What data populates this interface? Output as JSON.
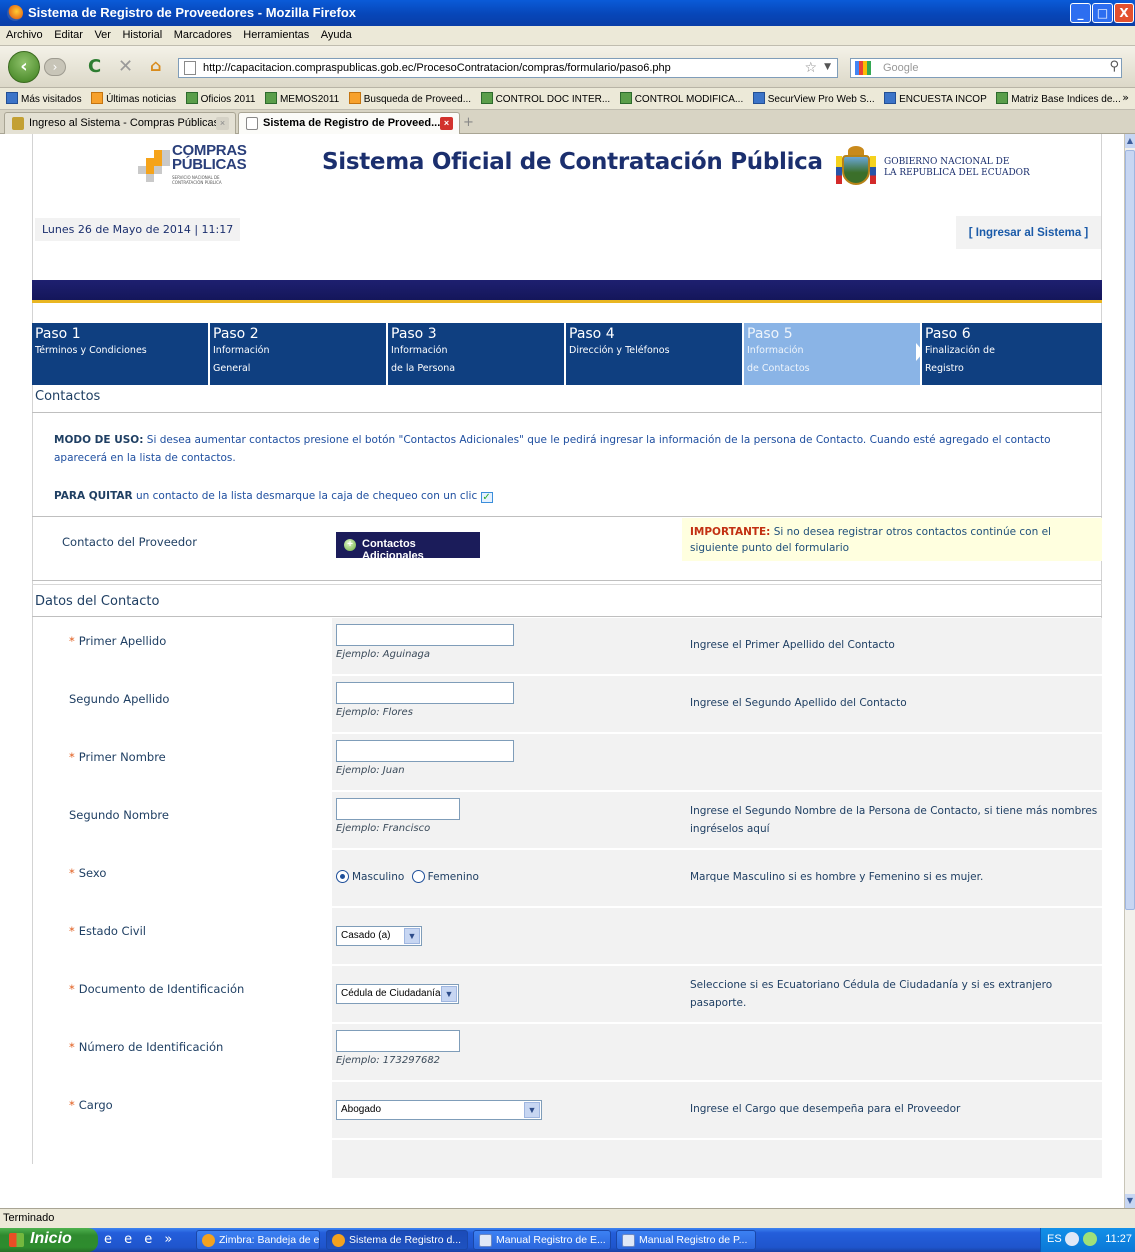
{
  "window": {
    "title": "Sistema de Registro de Proveedores - Mozilla Firefox",
    "buttons": {
      "minimize": "_",
      "maximize": "□",
      "close": "X"
    }
  },
  "menu": [
    "Archivo",
    "Editar",
    "Ver",
    "Historial",
    "Marcadores",
    "Herramientas",
    "Ayuda"
  ],
  "navbar": {
    "url": "http://capacitacion.compraspublicas.gob.ec/ProcesoContratacion/compras/formulario/paso6.php",
    "search_placeholder": "Google"
  },
  "bookmarks": [
    {
      "label": "Más visitados",
      "icon": "page-icon"
    },
    {
      "label": "Últimas noticias",
      "icon": "rss-icon"
    },
    {
      "label": "Oficios 2011",
      "icon": "sheet-icon"
    },
    {
      "label": "MEMOS2011",
      "icon": "sheet-icon"
    },
    {
      "label": "Busqueda de Proveed...",
      "icon": "crest-icon"
    },
    {
      "label": "CONTROL DOC INTER...",
      "icon": "sheet-icon"
    },
    {
      "label": "CONTROL MODIFICA...",
      "icon": "sheet-icon"
    },
    {
      "label": "SecurView Pro Web S...",
      "icon": "globe-icon"
    },
    {
      "label": "ENCUESTA INCOP",
      "icon": "google-icon"
    },
    {
      "label": "Matriz Base Indices de...",
      "icon": "sheet-icon"
    }
  ],
  "bookmarks_more": "»",
  "tabs": [
    {
      "label": "Ingreso al Sistema - Compras Públicas",
      "active": false
    },
    {
      "label": "Sistema de Registro de Proveed...",
      "active": true
    }
  ],
  "header": {
    "logo_line1": "COMPRAS",
    "logo_line2": "PÚBLICAS",
    "logo_tagline": "SERVICIO NACIONAL DE CONTRATACIÓN PÚBLICA",
    "site_title": "Sistema Oficial de Contratación Pública",
    "gov_line1": "GOBIERNO NACIONAL DE",
    "gov_line2": "LA REPUBLICA DEL ECUADOR",
    "datetime": "Lunes 26 de Mayo de 2014 | 11:17",
    "login": "[ Ingresar al Sistema ]"
  },
  "steps": [
    {
      "num": "Paso 1",
      "line1": "Términos y Condiciones",
      "line2": ""
    },
    {
      "num": "Paso 2",
      "line1": "Información",
      "line2": "General"
    },
    {
      "num": "Paso 3",
      "line1": "Información",
      "line2": "de la Persona"
    },
    {
      "num": "Paso 4",
      "line1": "Dirección y Teléfonos",
      "line2": ""
    },
    {
      "num": "Paso 5",
      "line1": "Información",
      "line2": "de Contactos"
    },
    {
      "num": "Paso 6",
      "line1": "Finalización de",
      "line2": "Registro"
    }
  ],
  "contactos": {
    "title": "Contactos",
    "usage_bold": "MODO DE USO:",
    "usage_text": " Si desea aumentar contactos presione el botón \"Contactos Adicionales\" que le pedirá ingresar la información de la persona de Contacto. Cuando esté agregado el contacto aparecerá en la lista de contactos.",
    "quitar_bold": "PARA QUITAR",
    "quitar_text": " un contacto de la lista desmarque la caja de chequeo con un clic",
    "row_label": "Contacto del Proveedor",
    "add_button": "Contactos Adicionales",
    "important_bold": "IMPORTANTE:",
    "important_text": " Si no desea registrar otros contactos continúe con el siguiente punto del formulario"
  },
  "datos": {
    "title": "Datos del Contacto",
    "rows": [
      {
        "label": "Primer Apellido",
        "required": true,
        "example": "Ejemplo: Aguinaga",
        "hint": "Ingrese el Primer Apellido del Contacto"
      },
      {
        "label": "Segundo Apellido",
        "required": false,
        "example": "Ejemplo: Flores",
        "hint": "Ingrese el Segundo Apellido del Contacto"
      },
      {
        "label": "Primer Nombre",
        "required": true,
        "example": "Ejemplo: Juan",
        "hint": ""
      },
      {
        "label": "Segundo Nombre",
        "required": false,
        "example": "Ejemplo: Francisco",
        "hint": "Ingrese el Segundo Nombre de la Persona de Contacto, si tiene más nombres ingréselos aquí"
      },
      {
        "label": "Sexo",
        "required": true,
        "hint": "Marque Masculino si es hombre y Femenino si es mujer.",
        "options": [
          "Masculino",
          "Femenino"
        ],
        "selected": "Masculino"
      },
      {
        "label": "Estado Civil",
        "required": true,
        "value": "Casado (a)",
        "hint": ""
      },
      {
        "label": "Documento de Identificación",
        "required": true,
        "value": "Cédula de Ciudadanía",
        "hint": "Seleccione si es Ecuatoriano Cédula de Ciudadanía y si es extranjero pasaporte."
      },
      {
        "label": "Número de Identificación",
        "required": true,
        "example": "Ejemplo: 173297682",
        "hint": ""
      },
      {
        "label": "Cargo",
        "required": true,
        "value": "Abogado",
        "hint": "Ingrese el Cargo que desempeña para el Proveedor"
      }
    ]
  },
  "status": "Terminado",
  "taskbar": {
    "start": "Inicio",
    "items": [
      {
        "label": "Zimbra: Bandeja de e...",
        "active": false
      },
      {
        "label": "Sistema de Registro d...",
        "active": true
      },
      {
        "label": "Manual Registro de E...",
        "active": false
      },
      {
        "label": "Manual Registro de P...",
        "active": false
      }
    ],
    "lang": "ES",
    "clock": "11:27"
  }
}
